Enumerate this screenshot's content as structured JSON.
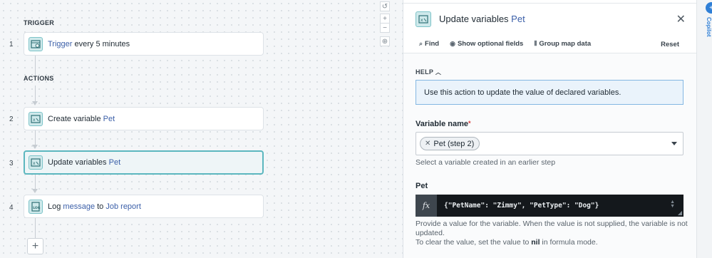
{
  "canvas": {
    "trigger_label": "TRIGGER",
    "actions_label": "ACTIONS",
    "steps": [
      {
        "num": "1",
        "parts": [
          "Trigger",
          " every 5 minutes"
        ],
        "icon": "clock-calendar-icon"
      },
      {
        "num": "2",
        "parts": [
          "Create variable ",
          "Pet"
        ],
        "icon": "variable-icon"
      },
      {
        "num": "3",
        "parts": [
          "Update variables ",
          "Pet"
        ],
        "icon": "variable-icon"
      },
      {
        "num": "4",
        "parts": [
          "Log ",
          "message",
          " to ",
          "Job report"
        ],
        "icon": "log-icon"
      }
    ],
    "zoom": {
      "reset": "↺",
      "in": "+",
      "out": "−",
      "fit": "⊕"
    },
    "add_step": "+"
  },
  "panel": {
    "title_prefix": "Update variables ",
    "title_var": "Pet",
    "close": "✕",
    "toolbar": {
      "find": "Find",
      "optional": "Show optional fields",
      "group_map": "Group map data",
      "reset": "Reset"
    },
    "help_label": "HELP",
    "help_text": "Use this action to update the value of declared variables.",
    "variable_label": "Variable name",
    "required_mark": "*",
    "variable_chip": "Pet (step 2)",
    "variable_hint": "Select a variable created in an earlier step",
    "pet_label": "Pet",
    "fx": "fx",
    "formula_value": "{\"PetName\": \"Zimmy\", \"PetType\": \"Dog\"}",
    "pet_hint_1": "Provide a value for the variable. When the value is not supplied, the variable is not updated.",
    "pet_hint_2a": "To clear the value, set the value to ",
    "pet_hint_nil": "nil",
    "pet_hint_2b": " in formula mode."
  },
  "sidestrip": {
    "badge": "+",
    "text": "Copilot"
  },
  "colors": {
    "accent": "#5cb7bf",
    "link": "#3b5fa8",
    "help_border": "#84b7e3"
  }
}
